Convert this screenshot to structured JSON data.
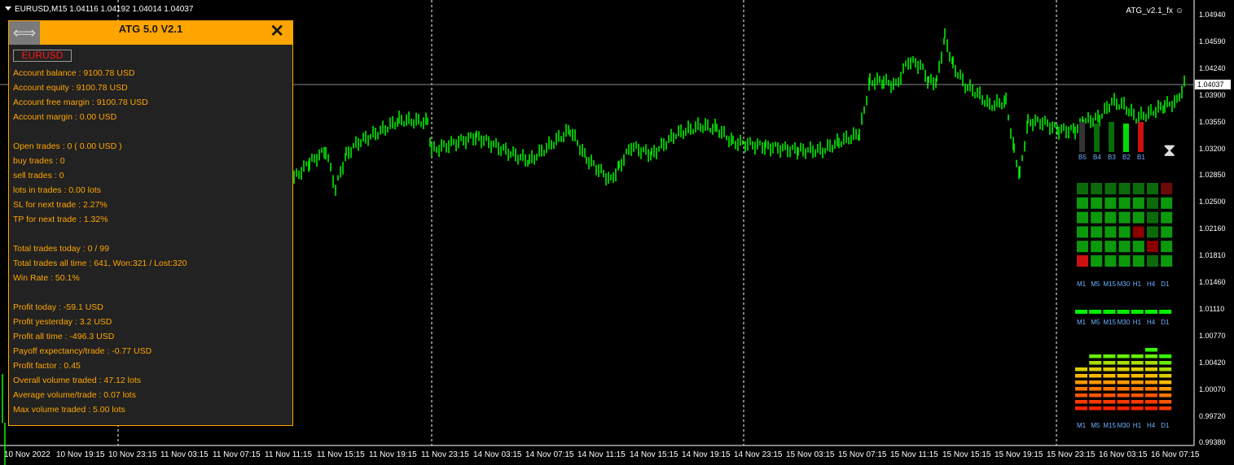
{
  "header": {
    "symbol_info": "EURUSD,M15  1.04116 1.04192 1.04014 1.04037",
    "ea_name": "ATG_v2.1_fx"
  },
  "current_price": "1.04037",
  "y_axis": [
    "1.04940",
    "1.04590",
    "1.04240",
    "1.03900",
    "1.03550",
    "1.03200",
    "1.02850",
    "1.02500",
    "1.02160",
    "1.01810",
    "1.01460",
    "1.01110",
    "1.00770",
    "1.00420",
    "1.00070",
    "0.99720",
    "0.99380"
  ],
  "x_axis": [
    "10 Nov 2022",
    "10 Nov 19:15",
    "10 Nov 23:15",
    "11 Nov 03:15",
    "11 Nov 07:15",
    "11 Nov 11:15",
    "11 Nov 15:15",
    "11 Nov 19:15",
    "11 Nov 23:15",
    "14 Nov 03:15",
    "14 Nov 07:15",
    "14 Nov 11:15",
    "14 Nov 15:15",
    "14 Nov 19:15",
    "14 Nov 23:15",
    "15 Nov 03:15",
    "15 Nov 07:15",
    "15 Nov 11:15",
    "15 Nov 15:15",
    "15 Nov 19:15",
    "15 Nov 23:15",
    "16 Nov 03:15",
    "16 Nov 07:15"
  ],
  "panel": {
    "title": "ATG 5.0 V2.1",
    "close_icon": "✕",
    "move_icon": "⟺",
    "symbol_button": "EURUSD",
    "lines": [
      "Account balance : 9100.78 USD",
      "Account equity : 9100.78 USD",
      "Account free margin : 9100.78 USD",
      "Account margin : 0.00 USD",
      "",
      "Open trades : 0 ( 0.00 USD )",
      "buy trades : 0",
      "sell trades : 0",
      "lots in trades : 0.00 lots",
      "SL for next trade : 2.27%",
      "TP for next trade : 1.32%",
      "",
      "Total trades today : 0 / 99",
      "Total trades all time : 641, Won:321 / Lost:320",
      "Win Rate : 50.1%",
      "",
      "Profit today : -59.1 USD",
      "Profit yesterday : 3.2 USD",
      "Profit all time : -496.3 USD",
      "Payoff expectancy/trade : -0.77 USD",
      "Profit factor : 0.45",
      "Overall volume traded : 47.12 lots",
      "Average volume/trade : 0.07 lots",
      "Max volume traded : 5.00 lots"
    ]
  },
  "bars_labels": [
    "B5",
    "B4",
    "B3",
    "B2",
    "B1"
  ],
  "timeframes": [
    "M1",
    "M5",
    "M15",
    "M30",
    "H1",
    "H4",
    "D1"
  ],
  "grid_reds": [
    "0-6",
    "3-4",
    "4-5",
    "5-0"
  ],
  "colors": {
    "candle": "#00FF00",
    "panel_border": "#FFA500",
    "panel_text": "#FFA500"
  }
}
